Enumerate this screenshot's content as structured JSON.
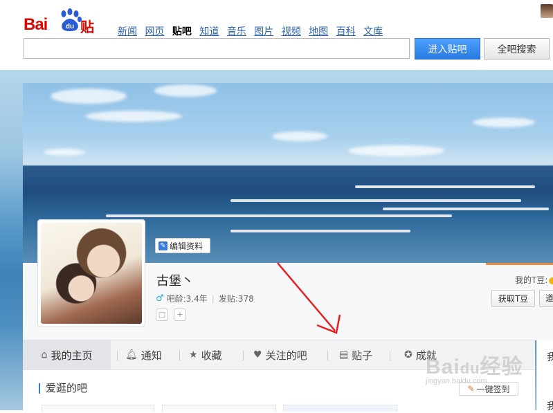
{
  "header": {
    "logo": "Bai du 贴吧",
    "nav": [
      "新闻",
      "网页",
      "贴吧",
      "知道",
      "音乐",
      "图片",
      "视频",
      "地图",
      "百科",
      "文库"
    ],
    "nav_current": "贴吧",
    "search": {
      "value": "",
      "placeholder": ""
    },
    "btn_enter": "进入贴吧",
    "btn_search_all": "全吧搜索"
  },
  "profile": {
    "edit_button": "编辑资料",
    "username": "古堡丶",
    "age_label": "吧龄:3.4年",
    "posts_label": "发贴:378",
    "tdou_label": "我的T豆:",
    "get_tdou_button": "获取T豆",
    "cut_button": "道"
  },
  "tabs": [
    {
      "label": "我的主页",
      "icon": "home-icon",
      "active": true
    },
    {
      "label": "通知",
      "icon": "bell-icon"
    },
    {
      "label": "收藏",
      "icon": "star-icon"
    },
    {
      "label": "关注的吧",
      "icon": "heart-icon"
    },
    {
      "label": "贴子",
      "icon": "document-icon"
    },
    {
      "label": "成就",
      "icon": "badge-icon"
    }
  ],
  "right_col": {
    "t1": "我",
    "t2": "我"
  },
  "content": {
    "section_title": "爱逛的吧",
    "sign_all": "一键签到"
  },
  "colors": {
    "brand_red": "#e10601",
    "link_blue": "#2d64b3",
    "button_blue": "#2a7ae2",
    "accent_orange": "#f08a3c",
    "arrow_red": "#e8201c"
  }
}
